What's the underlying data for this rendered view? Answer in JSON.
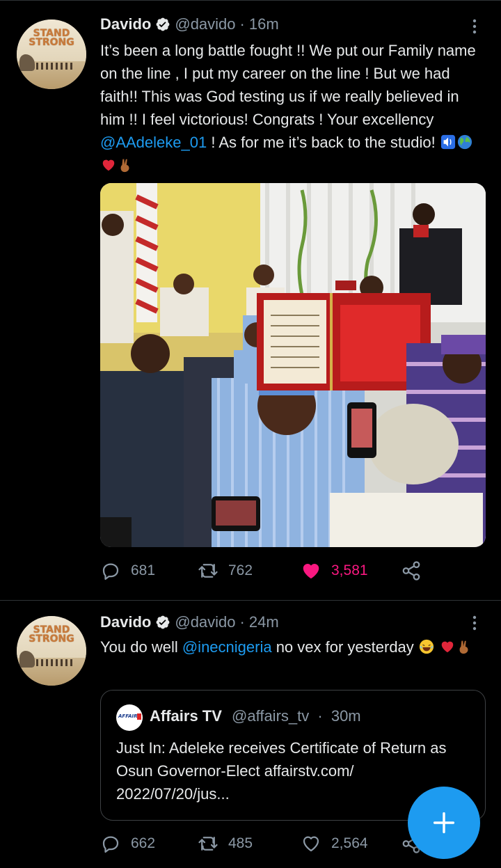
{
  "tweets": [
    {
      "author": "Davido",
      "handle": "@davido",
      "time": "16m",
      "text_before_mention": "It’s been a long battle fought !! We put our Family name on the line , I put my career on the line ! But we had faith!! This was God testing us if we really believed in him !! I feel victorious! Congrats ! Your excellency ",
      "mention": "@AAdeleke_01",
      "text_after_mention": " ! As for me it’s back to the studio! ",
      "emojis": [
        "speaker-icon",
        "globe-icon",
        "red-heart-icon",
        "victory-hand-icon"
      ],
      "avatar_text": "STAND STRONG",
      "replies": "681",
      "retweets": "762",
      "likes": "3,581",
      "liked": true
    },
    {
      "author": "Davido",
      "handle": "@davido",
      "time": "24m",
      "text_before_mention": "You do well ",
      "mention": "@inecnigeria",
      "text_after_mention": " no vex for yesterday ",
      "emojis": [
        "laughing-face-icon",
        "red-heart-icon",
        "victory-hand-icon"
      ],
      "avatar_text": "STAND STRONG",
      "quote": {
        "name": "Affairs TV",
        "handle": "@affairs_tv",
        "time": "30m",
        "avatar_text": "AFFAIRS",
        "text": "Just In: Adeleke receives Certificate of Return as Osun Governor-Elect affairstv.com/ 2022/07/20/jus..."
      },
      "replies": "662",
      "retweets": "485",
      "likes": "2,564",
      "liked": false
    }
  ],
  "separator": "·",
  "colors": {
    "accent": "#1d9bf0",
    "like": "#f91880",
    "secondary": "#8b98a5",
    "background": "#000000"
  }
}
